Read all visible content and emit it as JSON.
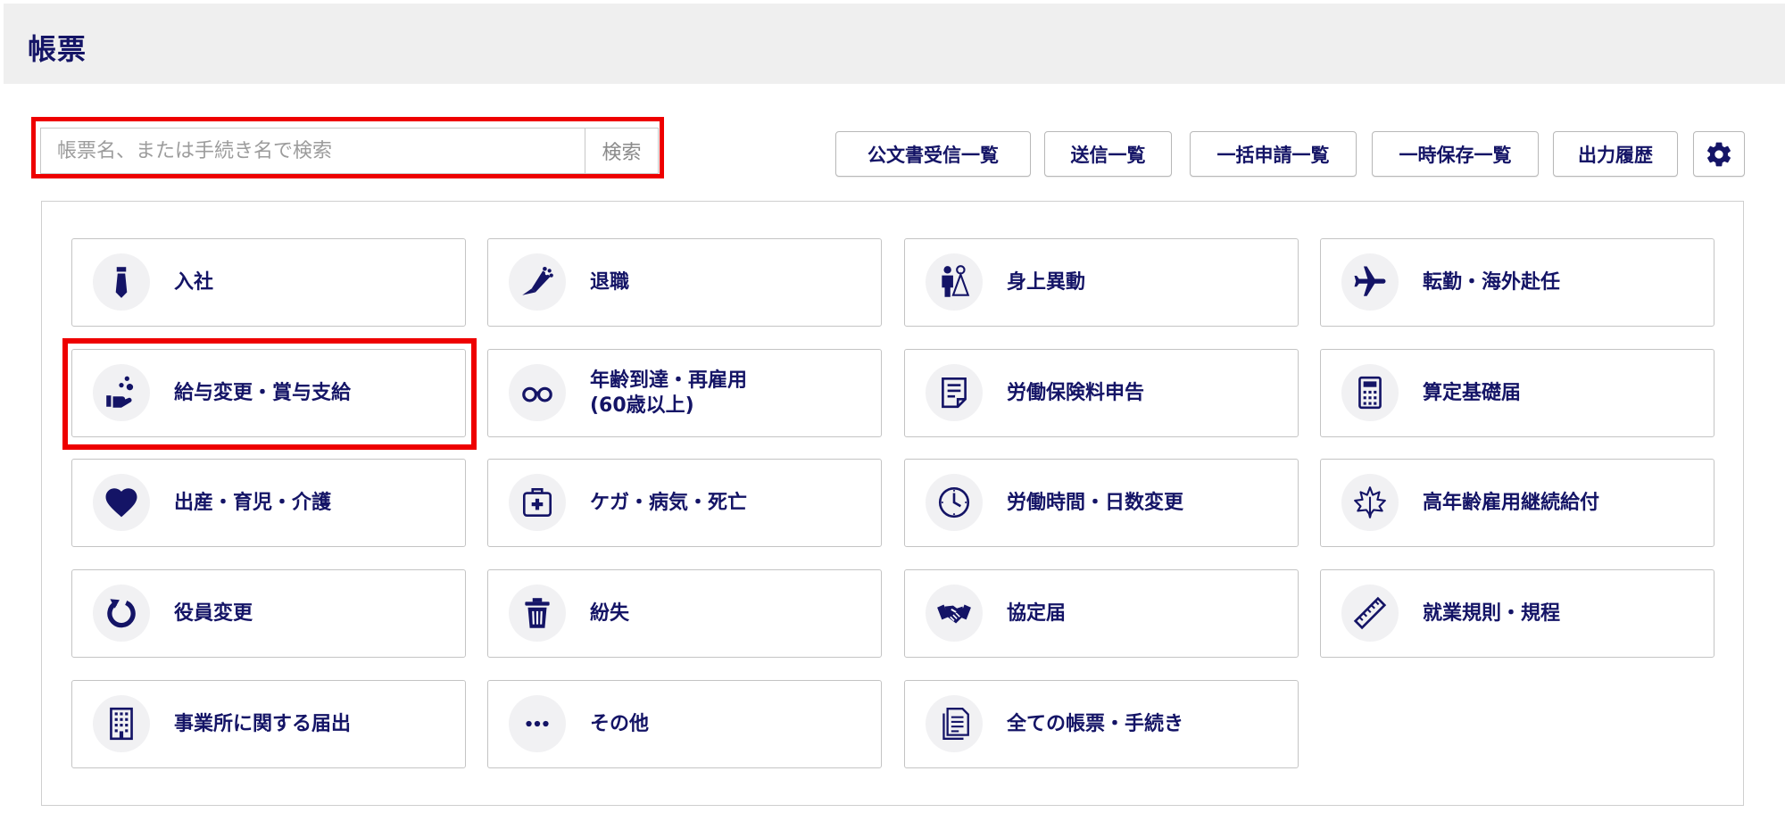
{
  "header": {
    "title": "帳票"
  },
  "search": {
    "placeholder": "帳票名、または手続き名で検索",
    "button_label": "検索"
  },
  "toolbar": {
    "buttons": [
      "公文書受信一覧",
      "送信一覧",
      "一括申請一覧",
      "一時保存一覧",
      "出力履歴"
    ],
    "settings_icon": "gear-icon"
  },
  "tiles": [
    {
      "label": "入社",
      "icon": "necktie-icon"
    },
    {
      "label": "退職",
      "icon": "bouquet-icon"
    },
    {
      "label": "身上異動",
      "icon": "couple-icon"
    },
    {
      "label": "転勤・海外赴任",
      "icon": "airplane-icon"
    },
    {
      "label": "給与変更・賞与支給",
      "icon": "hand-coins-icon"
    },
    {
      "label": "年齢到達・再雇用\n(60歳以上)",
      "icon": "glasses-icon"
    },
    {
      "label": "労働保険料申告",
      "icon": "document-icon"
    },
    {
      "label": "算定基礎届",
      "icon": "calculator-icon"
    },
    {
      "label": "出産・育児・介護",
      "icon": "heart-icon"
    },
    {
      "label": "ケガ・病気・死亡",
      "icon": "first-aid-kit-icon"
    },
    {
      "label": "労働時間・日数変更",
      "icon": "clock-icon"
    },
    {
      "label": "高年齢雇用継続給付",
      "icon": "maple-leaf-icon"
    },
    {
      "label": "役員変更",
      "icon": "refresh-icon"
    },
    {
      "label": "紛失",
      "icon": "trash-icon"
    },
    {
      "label": "協定届",
      "icon": "handshake-icon"
    },
    {
      "label": "就業規則・規程",
      "icon": "ruler-icon"
    },
    {
      "label": "事業所に関する届出",
      "icon": "building-icon"
    },
    {
      "label": "その他",
      "icon": "more-dots-icon"
    },
    {
      "label": "全ての帳票・手続き",
      "icon": "documents-icon"
    }
  ],
  "colors": {
    "navy": "#141466",
    "highlight": "#ee0000",
    "header_bg": "#efefef"
  }
}
